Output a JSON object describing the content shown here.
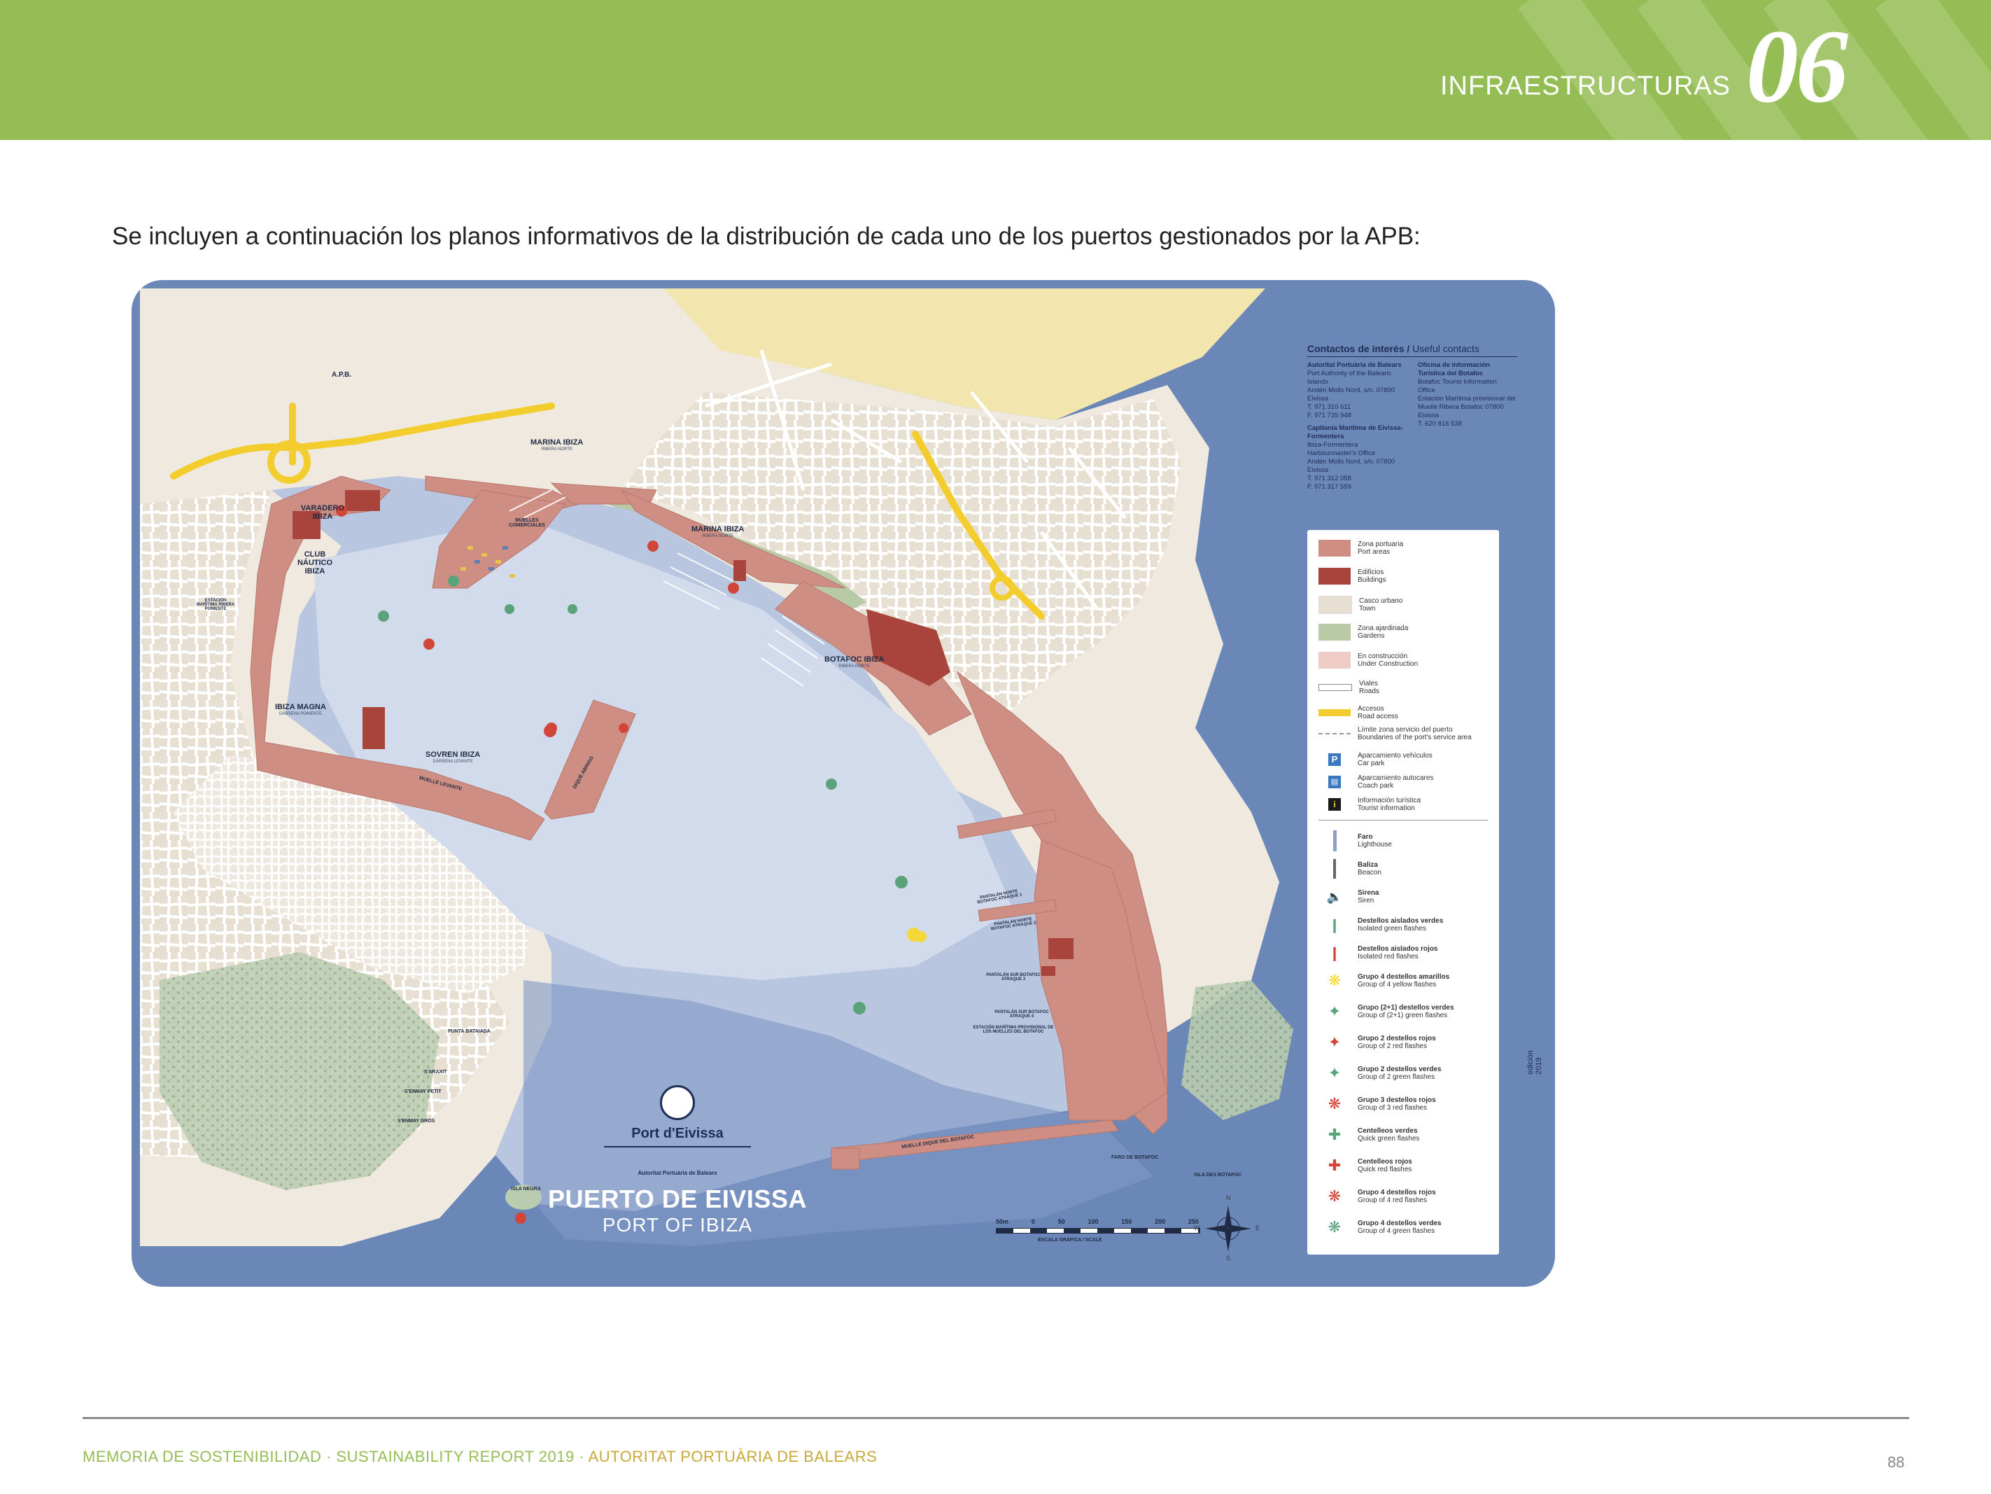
{
  "header": {
    "section_title": "INFRAESTRUCTURAS",
    "section_number": "06",
    "color": "#95bd55"
  },
  "intro_text": "Se incluyen a continuación los planos informativos de la distribución de cada uno de los puertos gestionados por la APB:",
  "map": {
    "brand": "Port d'Eivissa",
    "authority": "Autoritat Portuària de Balears",
    "title_es": "PUERTO DE EIVISSA",
    "title_en": "PORT OF IBIZA",
    "edition": "edición 2019",
    "contacts": {
      "title": "Contactos de interés /",
      "title_en": "Useful contacts",
      "apb": {
        "name": "Autoritat Portuària de Balears",
        "name_en": "Port Authority of the Balearic Islands",
        "address": "Andén Molls Nord, s/n. 07800 Eivissa",
        "tel": "T. 971 310 611",
        "fax": "F. 971 735 948"
      },
      "capitania": {
        "name": "Capitanía Marítima de Eivissa-Formentera",
        "name_en": "Ibiza-Formentera Harbourmaster's Office",
        "address": "Andén Molls Nord, s/n. 07800 Eivissa",
        "tel": "T. 971 312 058",
        "fax": "F. 971 317 559"
      },
      "info": {
        "name": "Oficina de información Turística del Botafoc",
        "name_en": "Botafoc Tourist Information Office",
        "address": "Estación Marítima provisional del Muelle Ribera Botafoc 07800 Eivissa",
        "tel": "T. 620 816 538"
      }
    },
    "legend": [
      {
        "label": "Zona portuaria",
        "label_en": "Port areas",
        "color": "#cf8e83"
      },
      {
        "label": "Edificios",
        "label_en": "Buildings",
        "color": "#a8443b"
      },
      {
        "label": "Casco urbano",
        "label_en": "Town",
        "color": "#e8dfd3"
      },
      {
        "label": "Zona ajardinada",
        "label_en": "Gardens",
        "color": "#b8c9a5"
      },
      {
        "label": "En construcción",
        "label_en": "Under Construction",
        "color": "#eecbc4"
      },
      {
        "label": "Viales",
        "label_en": "Roads",
        "color": "#ffffff"
      },
      {
        "label": "Accesos",
        "label_en": "Road access",
        "color": "#f3cd2d"
      },
      {
        "label": "Límite zona servicio del puerto",
        "label_en": "Boundaries of the port's service area",
        "color": "#999999"
      },
      {
        "label": "Aparcamiento vehículos",
        "label_en": "Car park",
        "icon": "P"
      },
      {
        "label": "Aparcamiento autocares",
        "label_en": "Coach park",
        "icon": "bus"
      },
      {
        "label": "Información turística",
        "label_en": "Tourist information",
        "icon": "i"
      },
      {
        "label": "Faro",
        "label_en": "Lighthouse"
      },
      {
        "label": "Baliza",
        "label_en": "Beacon"
      },
      {
        "label": "Sirena",
        "label_en": "Siren"
      },
      {
        "label": "Destellos aislados verdes",
        "label_en": "Isolated green flashes"
      },
      {
        "label": "Destellos aislados rojos",
        "label_en": "Isolated red flashes"
      },
      {
        "label": "Grupo 4 destellos amarillos",
        "label_en": "Group of 4 yellow flashes"
      },
      {
        "label": "Grupo (2+1) destellos verdes",
        "label_en": "Group of (2+1) green flashes"
      },
      {
        "label": "Grupo 2 destellos rojos",
        "label_en": "Group of 2 red flashes"
      },
      {
        "label": "Grupo 2 destellos verdes",
        "label_en": "Group of 2 green flashes"
      },
      {
        "label": "Grupo 3 destellos rojos",
        "label_en": "Group of 3 red flashes"
      },
      {
        "label": "Centelleos verdes",
        "label_en": "Quick green flashes"
      },
      {
        "label": "Centelleos rojos",
        "label_en": "Quick red flashes"
      },
      {
        "label": "Grupo 4 destellos rojos",
        "label_en": "Group of 4 red flashes"
      },
      {
        "label": "Grupo 4 destellos verdes",
        "label_en": "Group of 4 green flashes"
      }
    ],
    "places": {
      "marina_ibiza_n": {
        "name": "MARINA IBIZA",
        "sub": "RIBERA NORTE"
      },
      "marina_ibiza_c": {
        "name": "MARINA IBIZA",
        "sub": "RIBERA NORTE"
      },
      "varadero": {
        "name": "VARADERO IBIZA"
      },
      "club_nautico": {
        "name": "CLUB NÁUTICO IBIZA"
      },
      "ibiza_magna": {
        "name": "IBIZA MAGNA",
        "sub": "DÁRSENA PONIENTE"
      },
      "sovren": {
        "name": "SOVREN IBIZA",
        "sub": "DÁRSENA LEVANTE"
      },
      "botafoc_ibiza": {
        "name": "BOTAFOC IBIZA",
        "sub": "RIBERA NORTE"
      },
      "apb": "A.P.B.",
      "muelles_comerciales": "MUELLES COMERCIALES",
      "muelle_levante": "MUELLE LEVANTE",
      "dique_abrigo": "DIQUE ABRIGO",
      "muelle_botafoc": "MUELLE DIQUE DEL BOTAFOC",
      "faro_botafoc": "FARO DE BOTAFOC",
      "isla_negra": "ISLA NEGRA",
      "isla_botafoc": "ISLA DES BOTAFOC",
      "punta_bataiada": "PUNTA BATAIADA",
      "es_arasit": "S'ARAXIT",
      "en_mar_pet": "S'ENMAY PETIT",
      "en_mar_gros": "S'ENMAY GROS",
      "estacion_ribera_poniente": "ESTACIÓN MARÍTIMA RIBERA PONIENTE",
      "estacion_provisional": "ESTACIÓN MARÍTIMA PROVISIONAL DE LOS MUELLES DEL BOTAFOC",
      "pantalan1": "PANTALÁN NORTE BOTAFOC ATRAQUE 1",
      "pantalan2": "PANTALÁN NORTE BOTAFOC ATRAQUE 2",
      "pantalan3": "PANTALÁN SUR BOTAFOC ATRAQUE 3",
      "pantalan4": "PANTALÁN SUR BOTAFOC ATRAQUE 4"
    },
    "scale": {
      "ticks": [
        "50m",
        "0",
        "50",
        "100",
        "150",
        "200",
        "250"
      ],
      "label": "ESCALA GRÁFICA / SCALE"
    },
    "compass": [
      "N",
      "S",
      "E",
      "W"
    ]
  },
  "footer": {
    "part1": "MEMORIA DE SOSTENIBILIDAD · SUSTAINABILITY REPORT 2019 ·",
    "part2": "AUTORITAT PORTUÀRIA DE BALEARS",
    "page": "88"
  }
}
